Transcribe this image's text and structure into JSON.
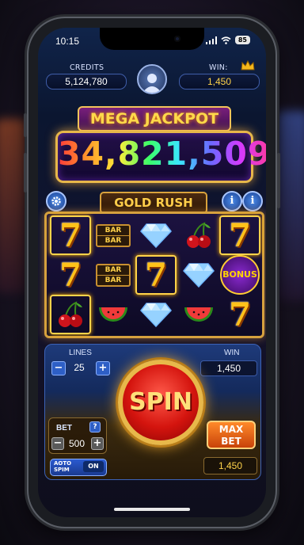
{
  "status_bar": {
    "time": "10:15",
    "battery": "85"
  },
  "header": {
    "credits_label": "CREDITS",
    "credits_value": "5,124,780",
    "win_label": "WIN:",
    "win_value": "1,450"
  },
  "jackpot": {
    "title": "MEGA JACKPOT",
    "amount": "34,821,509"
  },
  "game": {
    "title": "GOLD RUSH",
    "info_glyph": "i"
  },
  "reels": [
    [
      {
        "symbol": "7",
        "highlight": true
      },
      {
        "symbol": "7",
        "highlight": false
      },
      {
        "symbol": "cherry",
        "highlight": true
      }
    ],
    [
      {
        "symbol": "bar",
        "highlight": false
      },
      {
        "symbol": "bar",
        "highlight": false
      },
      {
        "symbol": "watermelon",
        "highlight": false
      }
    ],
    [
      {
        "symbol": "diamond",
        "highlight": false
      },
      {
        "symbol": "7",
        "highlight": true
      },
      {
        "symbol": "diamond",
        "highlight": false
      }
    ],
    [
      {
        "symbol": "cherry",
        "highlight": false
      },
      {
        "symbol": "diamond",
        "highlight": false
      },
      {
        "symbol": "watermelon",
        "highlight": false
      }
    ],
    [
      {
        "symbol": "7",
        "highlight": true
      },
      {
        "symbol": "bonus",
        "highlight": false
      },
      {
        "symbol": "7",
        "highlight": false
      }
    ]
  ],
  "symbols": {
    "bar_text": "BAR",
    "bonus_text": "BONUS",
    "seven_text": "7"
  },
  "controls": {
    "lines_label": "LINES",
    "lines_value": "25",
    "win_label": "WIN",
    "win_value": "1,450",
    "bet_label": "BET",
    "bet_value": "500",
    "spin_label": "SPIN",
    "max_bet_line1": "MAX",
    "max_bet_line2": "BET",
    "last_win_value": "1,450",
    "auto_spin_line1": "AOTO",
    "auto_spin_line2": "SPIM",
    "auto_spin_state": "ON",
    "minus": "−",
    "plus": "+"
  },
  "colors": {
    "accent_gold": "#e7b74a",
    "spin_red": "#d4140e",
    "panel_blue": "#1e3a7a"
  }
}
